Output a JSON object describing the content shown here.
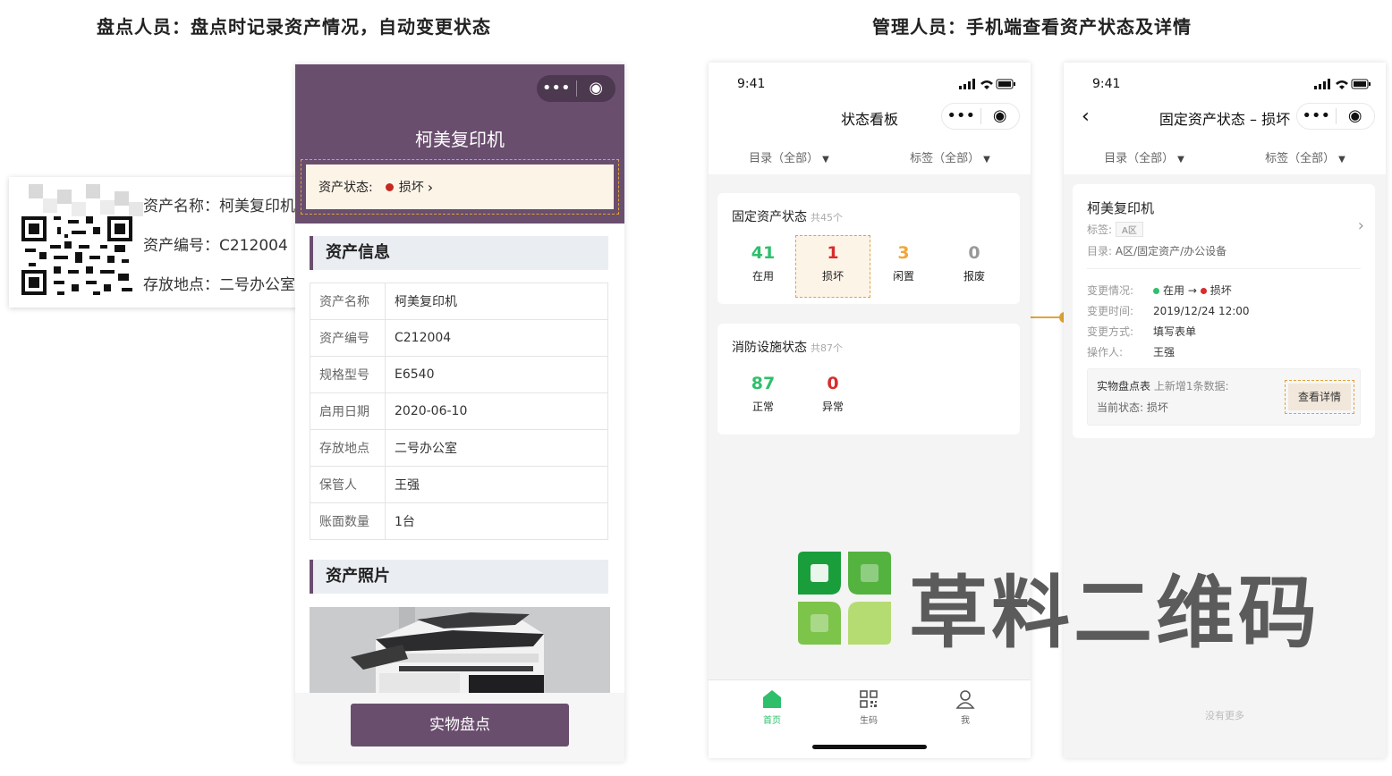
{
  "headers": {
    "left": "盘点人员：盘点时记录资产情况，自动变更状态",
    "right": "管理人员：手机端查看资产状态及详情"
  },
  "label": {
    "name": "资产名称：柯美复印机",
    "code": "资产编号：C212004",
    "location": "存放地点：二号办公室"
  },
  "asset_page": {
    "title": "柯美复印机",
    "status_label": "资产状态:",
    "status_value": "损坏",
    "info_section": "资产信息",
    "rows": [
      {
        "k": "资产名称",
        "v": "柯美复印机"
      },
      {
        "k": "资产编号",
        "v": "C212004"
      },
      {
        "k": "规格型号",
        "v": "E6540"
      },
      {
        "k": "启用日期",
        "v": "2020-06-10"
      },
      {
        "k": "存放地点",
        "v": "二号办公室"
      },
      {
        "k": "保管人",
        "v": "王强"
      },
      {
        "k": "账面数量",
        "v": "1台"
      }
    ],
    "photo_section": "资产照片",
    "button": "实物盘点"
  },
  "dashboard": {
    "time": "9:41",
    "title": "状态看板",
    "filter_catalog": "目录（全部）",
    "filter_tag": "标签（全部）",
    "fixed_title": "固定资产状态",
    "fixed_count": "共45个",
    "fixed_stats": [
      {
        "num": "41",
        "label": "在用",
        "color": "#2fbf6b"
      },
      {
        "num": "1",
        "label": "损坏",
        "color": "#d72d2d"
      },
      {
        "num": "3",
        "label": "闲置",
        "color": "#f0a73a"
      },
      {
        "num": "0",
        "label": "报废",
        "color": "#999999"
      }
    ],
    "fire_title": "消防设施状态",
    "fire_count": "共87个",
    "fire_stats": [
      {
        "num": "87",
        "label": "正常",
        "color": "#2fbf6b"
      },
      {
        "num": "0",
        "label": "异常",
        "color": "#d72d2d"
      }
    ],
    "tabs": {
      "home": "首页",
      "generate": "生码",
      "me": "我"
    },
    "accent_color": "#2fbf6b"
  },
  "detail": {
    "time": "9:41",
    "title": "固定资产状态 – 损坏",
    "filter_catalog": "目录（全部）",
    "filter_tag": "标签（全部）",
    "name": "柯美复印机",
    "tag_label": "标签:",
    "tag_value": "A区",
    "catalog_label": "目录:",
    "catalog_value": "A区/固定资产/办公设备",
    "change_label": "变更情况:",
    "change_from": "在用",
    "change_arrow": "→",
    "change_to": "损坏",
    "time_label": "变更时间:",
    "time_value": "2019/12/24 12:00",
    "method_label": "变更方式:",
    "method_value": "填写表单",
    "operator_label": "操作人:",
    "operator_value": "王强",
    "sub_title": "实物盘点表",
    "sub_note": "上新增1条数据:",
    "sub_state": "当前状态: 损坏",
    "sub_button": "查看详情",
    "no_more": "没有更多"
  },
  "watermark": {
    "text": "草料二维码",
    "logo_colors": [
      "#1a9e3c",
      "#54b33f",
      "#7dc44b",
      "#b5dc73"
    ]
  }
}
